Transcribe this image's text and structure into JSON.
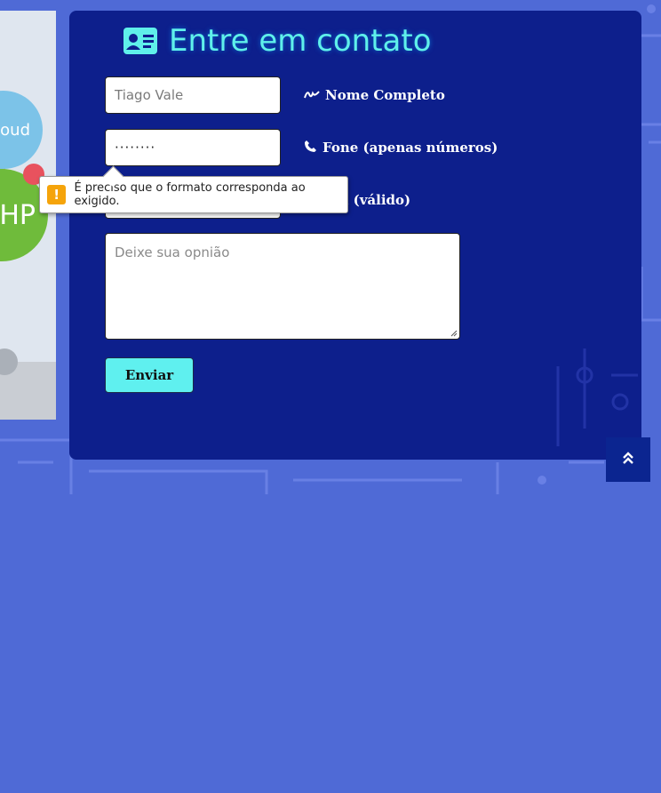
{
  "illustration": {
    "cloud_text": "Cloud",
    "php_text": "HP"
  },
  "contact": {
    "title": "Entre em contato",
    "title_icon": "id-card-icon",
    "name_field": {
      "value": "Tiago Vale",
      "label": "Nome Completo",
      "icon": "signature-icon"
    },
    "phone_field": {
      "value": "········",
      "label": "Fone (apenas números)",
      "icon": "phone-icon"
    },
    "email_field": {
      "label_visible": "il (válido)"
    },
    "message_field": {
      "placeholder": "Deixe sua opnião"
    },
    "submit_label": "Enviar"
  },
  "validation_tooltip": {
    "icon": "warning-icon",
    "message": "É preciso que o formato corresponda ao exigido."
  },
  "scroll_top": {
    "icon": "double-chevron-up-icon"
  },
  "colors": {
    "page_bg": "#4f6ad6",
    "panel_bg": "#0d1f8c",
    "accent_cyan": "#5ff0ef",
    "warning": "#f5a40b"
  }
}
